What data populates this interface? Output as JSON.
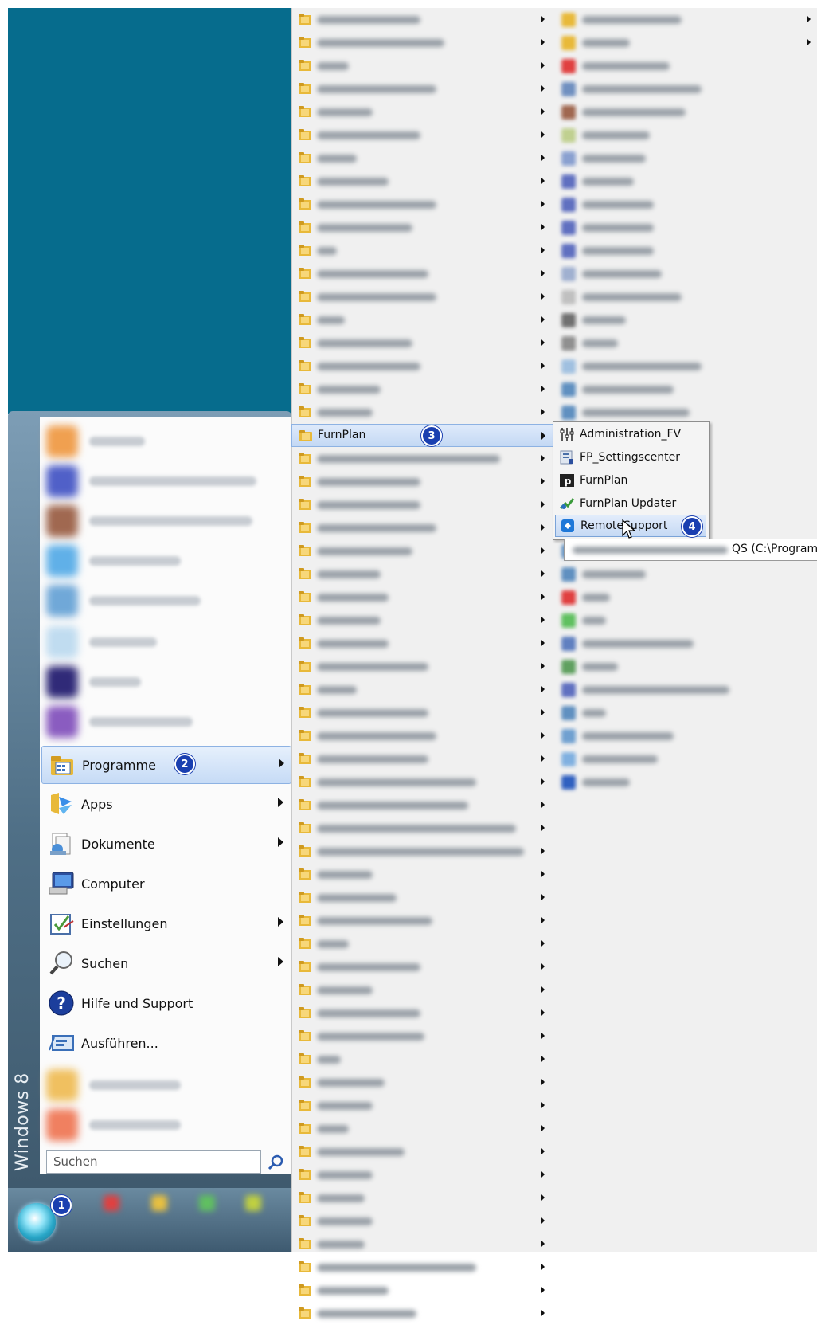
{
  "start_menu": {
    "side_label": "Windows 8",
    "items": [
      {
        "label": "Programme",
        "icon": "programs-folder-icon",
        "has_submenu": true,
        "badge": "2"
      },
      {
        "label": "Apps",
        "icon": "apps-icon",
        "has_submenu": true
      },
      {
        "label": "Dokumente",
        "icon": "documents-icon",
        "has_submenu": true
      },
      {
        "label": "Computer",
        "icon": "computer-icon",
        "has_submenu": false
      },
      {
        "label": "Einstellungen",
        "icon": "settings-icon",
        "has_submenu": true
      },
      {
        "label": "Suchen",
        "icon": "search-magnifier-icon",
        "has_submenu": true
      },
      {
        "label": "Hilfe und Support",
        "icon": "help-icon",
        "has_submenu": false
      },
      {
        "label": "Ausführen...",
        "icon": "run-icon",
        "has_submenu": false
      }
    ],
    "search_placeholder": "Suchen",
    "start_badge": "1"
  },
  "programs_menu": {
    "selected_label": "FurnPlan",
    "selected_badge": "3"
  },
  "furnplan_submenu": {
    "items": [
      {
        "label": "Administration_FV",
        "icon": "administration-sliders-icon"
      },
      {
        "label": "FP_Settingscenter",
        "icon": "settings-center-icon"
      },
      {
        "label": "FurnPlan",
        "icon": "furnplan-logo-icon"
      },
      {
        "label": "FurnPlan Updater",
        "icon": "updater-icon"
      },
      {
        "label": "RemoteSupport",
        "icon": "remote-support-icon",
        "selected": true,
        "badge": "4"
      }
    ]
  },
  "tooltip": {
    "visible_text": "QS (C:\\Program"
  },
  "colors": {
    "desktop": "#066c8d",
    "badge": "#1a3fb0",
    "folder": "#e8b93a",
    "selection": "#c6dbf6"
  }
}
